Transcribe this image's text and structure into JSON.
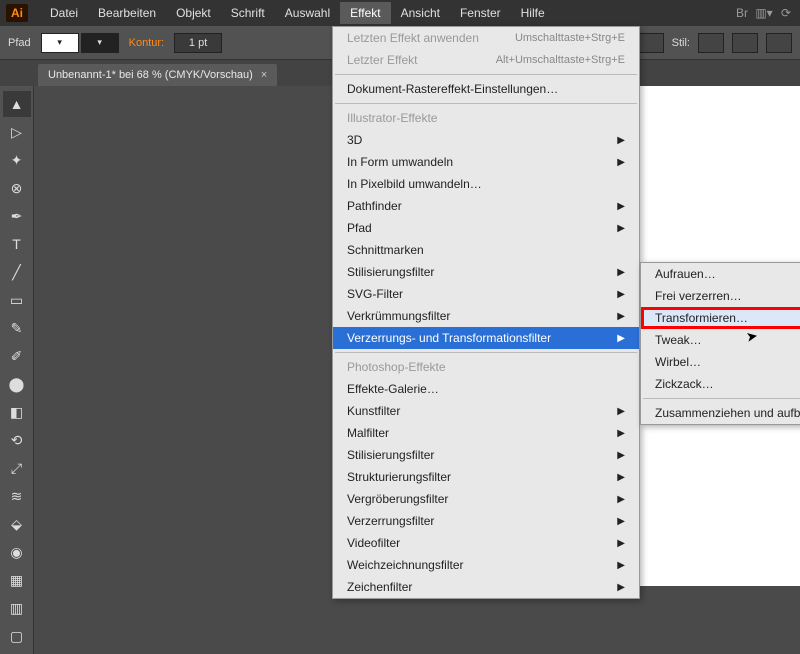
{
  "menubar": {
    "items": [
      "Datei",
      "Bearbeiten",
      "Objekt",
      "Schrift",
      "Auswahl",
      "Effekt",
      "Ansicht",
      "Fenster",
      "Hilfe"
    ],
    "active_index": 5
  },
  "options": {
    "mode_label": "Pfad",
    "stroke_label": "Kontur:",
    "stroke_value": "1 pt",
    "style_label": "Stil:"
  },
  "doc_tab": {
    "title": "Unbenannt-1* bei 68 % (CMYK/Vorschau)",
    "close": "×"
  },
  "tools": [
    "select",
    "direct",
    "wand",
    "lasso",
    "pen",
    "type",
    "line",
    "rect",
    "brush",
    "pencil",
    "blob",
    "eraser",
    "rotate",
    "scale",
    "width",
    "free",
    "shape",
    "grad",
    "eyedrop",
    "mesh",
    "graph",
    "artboard",
    "slice",
    "hand"
  ],
  "effect_menu": {
    "recent_apply": "Letzten Effekt anwenden",
    "recent_apply_shortcut": "Umschalttaste+Strg+E",
    "recent": "Letzter Effekt",
    "recent_shortcut": "Alt+Umschalttaste+Strg+E",
    "raster_settings": "Dokument-Rastereffekt-Einstellungen…",
    "illustrator_header": "Illustrator-Effekte",
    "illustrator_items": [
      "3D",
      "In Form umwandeln",
      "In Pixelbild umwandeln…",
      "Pathfinder",
      "Pfad",
      "Schnittmarken",
      "Stilisierungsfilter",
      "SVG-Filter",
      "Verkrümmungsfilter",
      "Verzerrungs- und Transformationsfilter"
    ],
    "photoshop_header": "Photoshop-Effekte",
    "photoshop_items": [
      "Effekte-Galerie…",
      "Kunstfilter",
      "Malfilter",
      "Stilisierungsfilter",
      "Strukturierungsfilter",
      "Vergröberungsfilter",
      "Verzerrungsfilter",
      "Videofilter",
      "Weichzeichnungsfilter",
      "Zeichenfilter"
    ]
  },
  "submenu": {
    "items": [
      "Aufrauen…",
      "Frei verzerren…",
      "Transformieren…",
      "Tweak…",
      "Wirbel…",
      "Zickzack…"
    ],
    "highlighted_index": 2,
    "last": "Zusammenziehen und aufblasen…"
  }
}
